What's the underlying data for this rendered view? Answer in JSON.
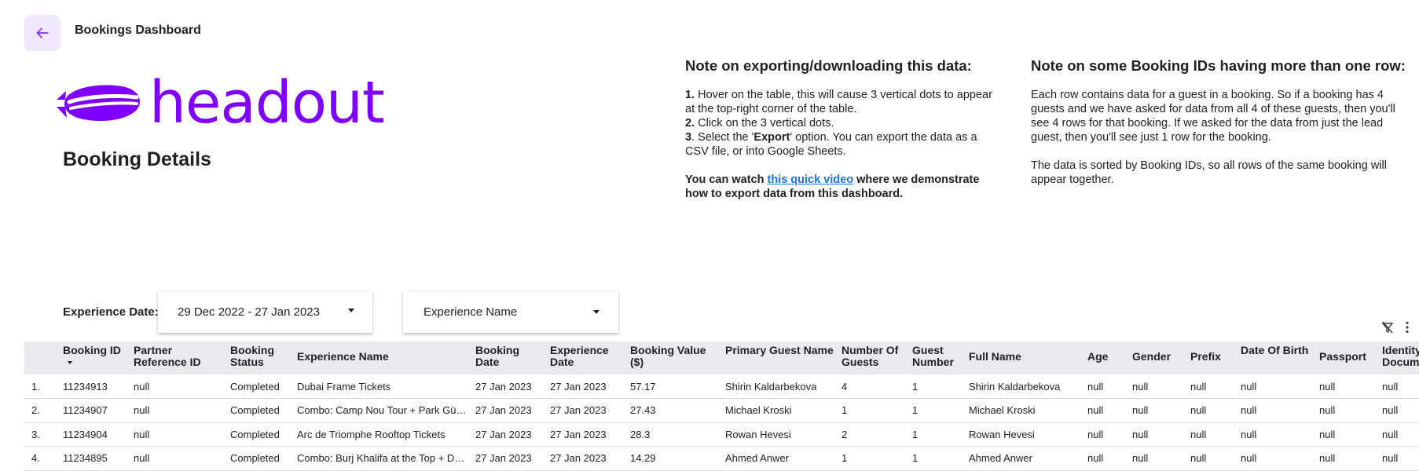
{
  "header": {
    "title": "Bookings Dashboard"
  },
  "logo": {
    "text": "headout",
    "color": "#8000ff"
  },
  "page_heading": "Booking Details",
  "note_export": {
    "title": "Note on exporting/downloading this data:",
    "steps": [
      {
        "num": "1.",
        "text": " Hover on the table, this will cause 3 vertical dots to appear at the top-right corner of the table."
      },
      {
        "num": "2.",
        "text": " Click on the 3 vertical dots."
      },
      {
        "num": "3",
        "text_before": ". Select the '",
        "bold": "Export",
        "text_after": "' option. You can export the data as a CSV file, or into Google Sheets."
      }
    ],
    "video_before": "You can watch ",
    "video_link": "this quick video",
    "video_after": " where we demonstrate how to export data from this dashboard."
  },
  "note_ids": {
    "title": "Note on some Booking IDs having more than one row:",
    "p1": "Each row contains data for a guest in a booking. So if a booking has 4 guests and we have asked for data from all 4 of these guests, then you'll see 4 rows for that booking. If we asked for the data from just the lead guest, then you'll see just 1 row for the booking.",
    "p2": "The data is sorted by Booking IDs, so all rows of the same booking will appear together."
  },
  "filters": {
    "label": "Experience Date:",
    "date_value": "29 Dec 2022 - 27 Jan 2023",
    "experience_placeholder": "Experience Name"
  },
  "table": {
    "columns": [
      "",
      "Booking ID",
      "Partner Reference ID",
      "Booking Status",
      "Experience Name",
      "Booking Date",
      "Experience Date",
      "Booking Value ($)",
      "Primary Guest Name",
      "Number Of Guests",
      "Guest Number",
      "Full Name",
      "Age",
      "Gender",
      "Prefix",
      "Date Of Birth",
      "Passport",
      "Identity Docum"
    ],
    "rows": [
      [
        "1.",
        "11234913",
        "null",
        "Completed",
        "Dubai Frame Tickets",
        "27 Jan 2023",
        "27 Jan 2023",
        "57.17",
        "Shirin Kaldarbekova",
        "4",
        "1",
        "Shirin Kaldarbekova",
        "null",
        "null",
        "null",
        "null",
        "null",
        "null"
      ],
      [
        "2.",
        "11234907",
        "null",
        "Completed",
        "Combo: Camp Nou Tour + Park Güel…",
        "27 Jan 2023",
        "27 Jan 2023",
        "27.43",
        "Michael Kroski",
        "1",
        "1",
        "Michael Kroski",
        "null",
        "null",
        "null",
        "null",
        "null",
        "null"
      ],
      [
        "3.",
        "11234904",
        "null",
        "Completed",
        "Arc de Triomphe Rooftop Tickets",
        "27 Jan 2023",
        "27 Jan 2023",
        "28.3",
        "Rowan Hevesi",
        "2",
        "1",
        "Rowan Hevesi",
        "null",
        "null",
        "null",
        "null",
        "null",
        "null"
      ],
      [
        "4.",
        "11234895",
        "null",
        "Completed",
        "Combo: Burj Khalifa at the Top + Du…",
        "27 Jan 2023",
        "27 Jan 2023",
        "14.29",
        "Ahmed Anwer",
        "1",
        "1",
        "Ahmed Anwer",
        "null",
        "null",
        "null",
        "null",
        "null",
        "null"
      ]
    ]
  },
  "icons": {
    "back": "arrow-left-icon",
    "logo": "blimp-icon",
    "dropdown": "caret-down-icon",
    "filter_off": "filter-off-icon",
    "more": "more-vertical-icon",
    "sort": "sort-descending-icon"
  }
}
